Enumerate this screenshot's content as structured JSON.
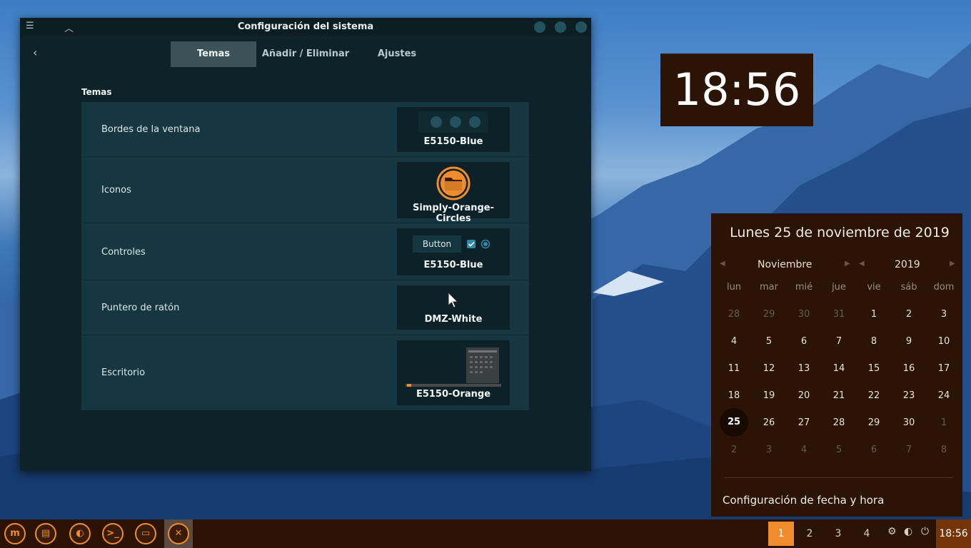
{
  "window": {
    "title": "Configuración del sistema",
    "tabs": [
      "Temas",
      "Añadir / Eliminar",
      "Ajustes"
    ],
    "section_title": "Temas",
    "rows": [
      {
        "label": "Bordes de la ventana",
        "theme": "E5150-Blue"
      },
      {
        "label": "Iconos",
        "theme": "Simply-Orange-Circles"
      },
      {
        "label": "Controles",
        "theme": "E5150-Blue",
        "button_text": "Button"
      },
      {
        "label": "Puntero de ratón",
        "theme": "DMZ-White"
      },
      {
        "label": "Escritorio",
        "theme": "E5150-Orange"
      }
    ]
  },
  "clock_widget": {
    "time": "18:56"
  },
  "calendar": {
    "date_title": "Lunes 25 de noviembre de 2019",
    "month": "Noviembre",
    "year": "2019",
    "weekdays": [
      "lun",
      "mar",
      "mié",
      "jue",
      "vie",
      "sáb",
      "dom"
    ],
    "weeks": [
      [
        "28",
        "29",
        "30",
        "31",
        "1",
        "2",
        "3"
      ],
      [
        "4",
        "5",
        "6",
        "7",
        "8",
        "9",
        "10"
      ],
      [
        "11",
        "12",
        "13",
        "14",
        "15",
        "16",
        "17"
      ],
      [
        "18",
        "19",
        "20",
        "21",
        "22",
        "23",
        "24"
      ],
      [
        "25",
        "26",
        "27",
        "28",
        "29",
        "30",
        "1"
      ],
      [
        "2",
        "3",
        "4",
        "5",
        "6",
        "7",
        "8"
      ]
    ],
    "today": "25",
    "settings_link": "Configuración de fecha y hora"
  },
  "taskbar": {
    "workspaces": [
      "1",
      "2",
      "3",
      "4"
    ],
    "active_workspace": "1",
    "time": "18:56",
    "accent": "#f08c2c"
  }
}
